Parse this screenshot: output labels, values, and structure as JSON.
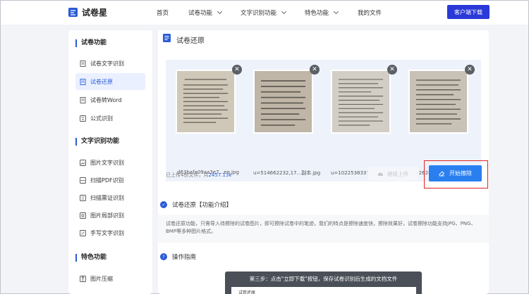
{
  "header": {
    "logo_text": "试卷星",
    "nav": [
      "首页",
      "试卷功能",
      "文字识别功能",
      "特色功能",
      "我的文件"
    ],
    "download_label": "客户端下载"
  },
  "sidebar": {
    "groups": [
      {
        "title": "试卷功能",
        "items": [
          "试卷文字识别",
          "试卷还原",
          "试卷转Word",
          "公式识别"
        ]
      },
      {
        "title": "文字识别功能",
        "items": [
          "图片文字识别",
          "扫描PDF识别",
          "扫描票证识别",
          "图片局部识别",
          "手写文字识别"
        ]
      },
      {
        "title": "特色功能",
        "items": [
          "图片压缩"
        ]
      }
    ],
    "active_item": "试卷还原"
  },
  "main": {
    "page_title": "试卷还原",
    "files": [
      "d63bafa09aa3e7...ee.jpg",
      "u=514662232,17...副本.jpg",
      "u=1022538337,4...副本.jpg",
      "u=2262820415,3...副本.jpg"
    ],
    "status_prefix": "已上传4份文件，共",
    "status_size": "2457.13k",
    "continue_label": "继续上传",
    "start_label": "开始擦除",
    "intro_title": "试卷还原【功能介绍】",
    "intro_text": "试卷还原功能，只需导入待擦除的试卷图片，即可擦除试卷中的笔迹，我们的特点是擦除速度快，擦除效果好，试卷擦除功能支持JPG、PNG、BMP等多种图片格式。",
    "guide_title": "操作指南",
    "guide_step": "第三步：点击\"立即下载\"按钮，保存试卷识别后生成的文档文件",
    "guide_sub": "试卷还原"
  },
  "colors": {
    "accent": "#2a5bd7",
    "download_button": "#2a39d8",
    "start_button": "#2a7ff0",
    "highlight": "#e02020"
  }
}
